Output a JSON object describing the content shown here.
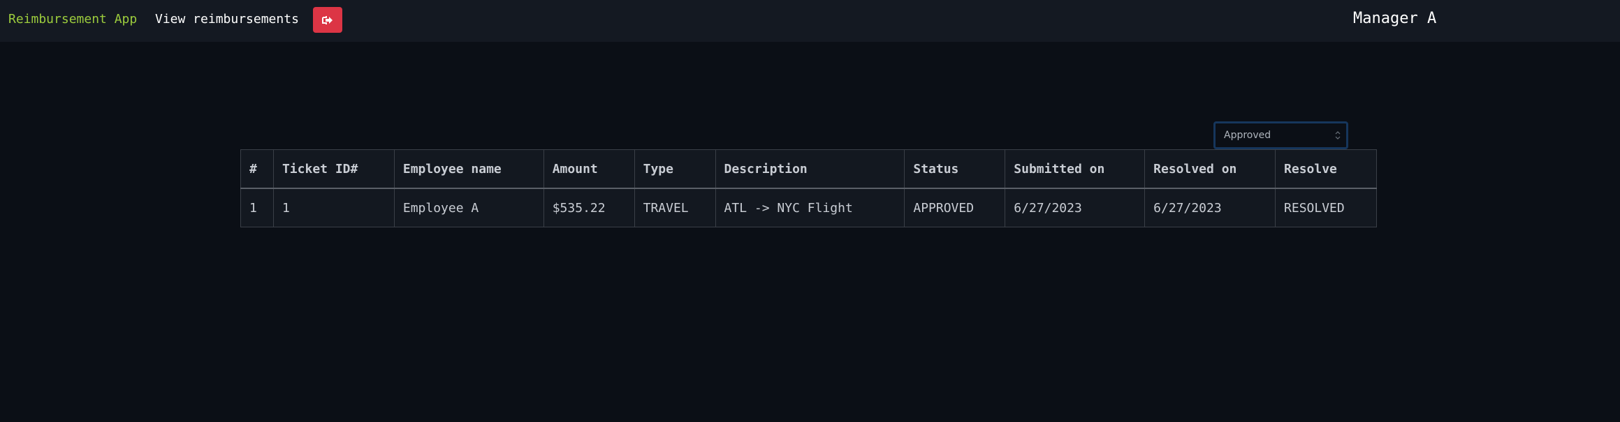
{
  "navbar": {
    "brand": "Reimbursement App",
    "view_link": "View reimbursements",
    "logout_icon": "sign-out-icon",
    "user": "Manager A"
  },
  "filter": {
    "selected": "Approved"
  },
  "table": {
    "headers": [
      "#",
      "Ticket ID#",
      "Employee name",
      "Amount",
      "Type",
      "Description",
      "Status",
      "Submitted on",
      "Resolved on",
      "Resolve"
    ],
    "rows": [
      [
        "1",
        "1",
        "Employee A",
        "$535.22",
        "TRAVEL",
        "ATL -> NYC Flight",
        "APPROVED",
        "6/27/2023",
        "6/27/2023",
        "RESOLVED"
      ]
    ]
  },
  "colors": {
    "brand": "#9ccc3d",
    "logout_button": "#dc3545",
    "background": "#0b0f16",
    "navbar": "#141922"
  }
}
